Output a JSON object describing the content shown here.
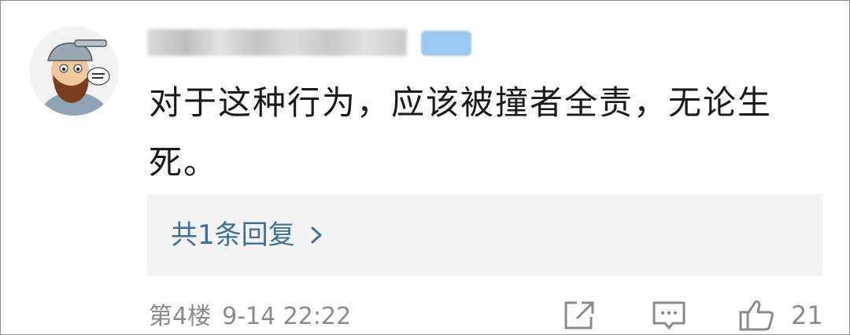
{
  "comment": {
    "username": "",
    "text": "对于这种行为，应该被撞者全责，无论生死。",
    "reply_link": "共1条回复",
    "floor": "第4楼",
    "time": "9-14 22:22",
    "like_count": "21"
  },
  "icons": {
    "avatar": "bearded-man-avatar",
    "reply_chevron": "chevron-right-icon",
    "share": "share-icon",
    "comment": "comment-icon",
    "like": "thumbs-up-icon"
  },
  "colors": {
    "link": "#3d6e9e",
    "meta": "#8a8a8a",
    "reply_bg": "#f3f3f3"
  }
}
